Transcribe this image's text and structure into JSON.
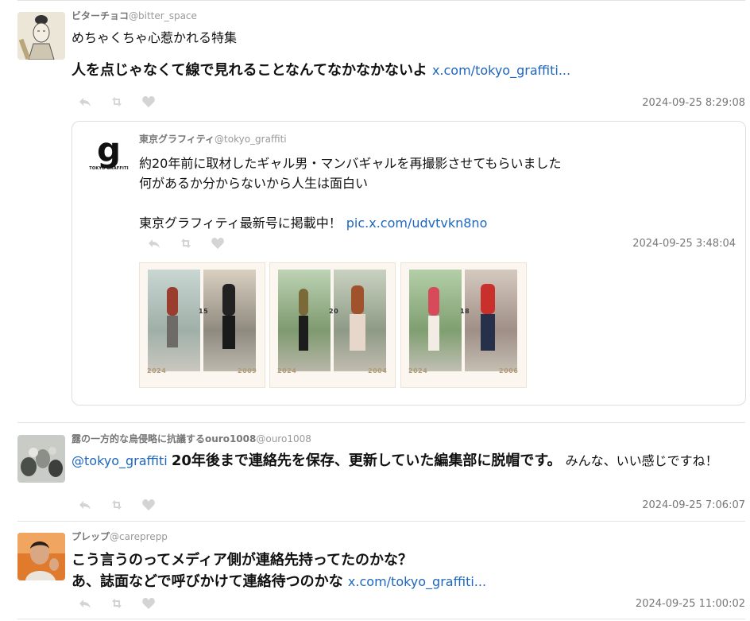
{
  "posts": [
    {
      "display_name": "ビターチョコ",
      "username": "@bitter_space",
      "text_line1": "めちゃくちゃ心惹かれる特集",
      "text_line2": "人を点じゃなくて線で見れることなんてなかなかないよ",
      "link": "x.com/tokyo_graffiti...",
      "timestamp": "2024-09-25 8:29:08",
      "avatar_icon": "illustrated-portrait-avatar"
    },
    {
      "display_name": "露の一方的な烏侵略に抗議するouro1008",
      "username": "@ouro1008",
      "mention": "@tokyo_graffiti",
      "text_bold": "20年後まで連絡先を保存、更新していた編集部に脱帽です。",
      "text_rest": "みんな、いい感じですね！",
      "timestamp": "2024-09-25 7:06:07",
      "avatar_icon": "figurines-photo-avatar"
    },
    {
      "display_name": "プレップ",
      "username": "@careprepp",
      "text_line1": "こう言うのってメディア側が連絡先持ってたのかな？",
      "text_line2": "あ、誌面などで呼びかけて連絡待つのかな",
      "link": "x.com/tokyo_graffiti...",
      "timestamp": "2024-09-25 11:00:02",
      "avatar_icon": "person-photo-avatar"
    }
  ],
  "quoted": {
    "display_name": "東京グラフィティ",
    "username": "@tokyo_graffiti",
    "line1": "約20年前に取材したギャル男・マンバギャルを再撮影させてもらいました",
    "line2": "何があるか分からないから人生は面白い",
    "line3": "東京グラフィティ最新号に掲載中！",
    "link": "pic.x.com/udvtvkn8no",
    "timestamp": "2024-09-25 3:48:04",
    "logo_letter": "g",
    "logo_text": "TOKYO GRAFFITI",
    "images": [
      {
        "year_left": "2024",
        "year_right": "2009",
        "number": "15"
      },
      {
        "year_left": "2024",
        "year_right": "2004",
        "number": "20"
      },
      {
        "year_left": "2024",
        "year_right": "2006",
        "number": "18"
      }
    ]
  },
  "colors": {
    "link": "#1d66c1",
    "icon": "#d4d4d4",
    "timestamp": "#777777",
    "border": "#dedede"
  },
  "icons": [
    "reply-icon",
    "retweet-icon",
    "like-icon"
  ]
}
